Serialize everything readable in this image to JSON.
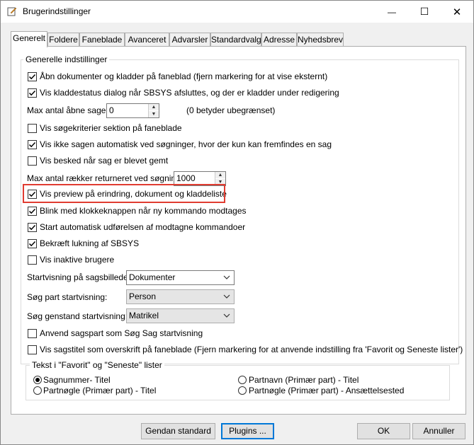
{
  "window": {
    "title": "Brugerindstillinger",
    "minimize": "—",
    "maximize": "☐",
    "close": "✕"
  },
  "tabs": [
    "Generelt",
    "Foldere",
    "Faneblade",
    "Avanceret",
    "Advarsler",
    "Standardvalg",
    "Adresse",
    "Nyhedsbrev"
  ],
  "group_general": {
    "legend": "Generelle indstillinger",
    "items": {
      "open_docs": {
        "label": "Åbn dokumenter og kladder på faneblad (fjern markering for at vise eksternt)",
        "checked": true
      },
      "draft_status": {
        "label": "Vis kladdestatus dialog når SBSYS afsluttes, og der er kladder under redigering",
        "checked": true
      },
      "max_cases_label": "Max antal åbne sager:",
      "max_cases_value": "0",
      "max_cases_note": "(0 betyder ubegrænset)",
      "search_criteria": {
        "label": "Vis søgekriterier sektion på faneblade",
        "checked": false
      },
      "no_auto_open": {
        "label": "Vis ikke sagen automatisk ved søgninger, hvor der kun kan fremfindes en sag",
        "checked": true
      },
      "hidden_msg": {
        "label": "Vis besked når sag er blevet gemt",
        "checked": false
      },
      "max_rows_label": "Max antal rækker returneret ved søgning:",
      "max_rows_value": "1000",
      "preview": {
        "label": "Vis preview på erindring, dokument og kladdeliste",
        "checked": true
      },
      "blink": {
        "label": "Blink med klokkeknappen når ny kommando modtages",
        "checked": true
      },
      "auto_exec": {
        "label": "Start automatisk udførelsen af modtagne kommandoer",
        "checked": true
      },
      "confirm_close": {
        "label": "Bekræft lukning af SBSYS",
        "checked": true
      },
      "inactive_users": {
        "label": "Vis inaktive brugere",
        "checked": false
      },
      "start_view_label": "Startvisning på sagsbilledet:",
      "start_view_value": "Dokumenter",
      "party_view_label": "Søg part startvisning:",
      "party_view_value": "Person",
      "object_view_label": "Søg genstand startvisning:",
      "object_view_value": "Matrikel",
      "use_party": {
        "label": "Anvend sagspart som Søg Sag startvisning",
        "checked": false
      },
      "case_title": {
        "label": "Vis sagstitel som overskrift på faneblade (Fjern markering for at anvende indstilling fra 'Favorit og Seneste lister')",
        "checked": false
      }
    }
  },
  "group_text": {
    "legend": "Tekst i \"Favorit\" og \"Seneste\" lister",
    "options": [
      {
        "label": "Sagnummer- Titel",
        "selected": true
      },
      {
        "label": "Partnavn (Primær part) - Titel",
        "selected": false
      },
      {
        "label": "Partnøgle (Primær part) - Titel",
        "selected": false
      },
      {
        "label": "Partnøgle (Primær part) - Ansættelsested",
        "selected": false
      }
    ]
  },
  "buttons": {
    "reset": "Gendan standard",
    "plugins": "Plugins ...",
    "ok": "OK",
    "cancel": "Annuller"
  }
}
